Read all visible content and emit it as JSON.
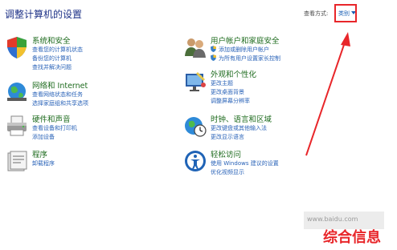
{
  "header": {
    "title": "调整计算机的设置",
    "view_by_label": "查看方式:",
    "view_by_value": "类别"
  },
  "categories": [
    {
      "name": "系统和安全",
      "icon": "shield-icon",
      "links": [
        "查看您的计算机状态",
        "备份您的计算机",
        "查找并解决问题"
      ]
    },
    {
      "name": "用户帐户和家庭安全",
      "icon": "users-icon",
      "links": [
        "添加或删除用户帐户",
        "为所有用户设置家长控制"
      ]
    },
    {
      "name": "网络和 Internet",
      "icon": "network-icon",
      "links": [
        "查看网络状态和任务",
        "选择家庭组和共享选项"
      ]
    },
    {
      "name": "外观和个性化",
      "icon": "appearance-icon",
      "links": [
        "更改主题",
        "更改桌面背景",
        "调整屏幕分辨率"
      ]
    },
    {
      "name": "硬件和声音",
      "icon": "printer-icon",
      "links": [
        "查看设备和打印机",
        "添加设备"
      ]
    },
    {
      "name": "时钟、语言和区域",
      "icon": "clock-globe-icon",
      "links": [
        "更改键盘或其他输入法",
        "更改显示语言"
      ]
    },
    {
      "name": "程序",
      "icon": "programs-icon",
      "links": [
        "卸载程序"
      ]
    },
    {
      "name": "轻松访问",
      "icon": "ease-of-access-icon",
      "links": [
        "使用 Windows 建议的设置",
        "优化视频显示"
      ]
    }
  ],
  "watermark": "www.baidu.com",
  "badge": "综合信息",
  "colors": {
    "annotation": "#e8262a",
    "category_heading": "#1e6b1e",
    "link": "#2a63b8"
  }
}
